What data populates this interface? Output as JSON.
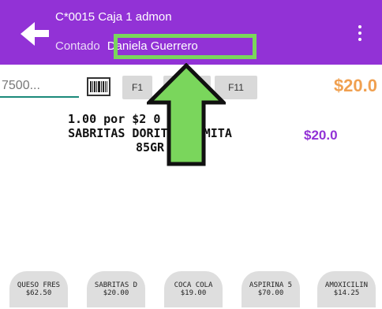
{
  "header": {
    "title": "C*0015 Caja 1 admon",
    "subtitle_prefix": "Contado",
    "cashier_name": "Daniela Guerrero",
    "background_color": "#9232d6",
    "highlight_color": "#7ad65c"
  },
  "search": {
    "value": "7500...",
    "barcode_icon": "barcode-icon"
  },
  "function_keys": [
    {
      "label": "F1"
    },
    {
      "label": "F"
    },
    {
      "label": "F11"
    }
  ],
  "total": {
    "amount": "$20.0",
    "color": "#f0a050"
  },
  "items": [
    {
      "quantity_line": "1.00 por $2  0",
      "description_line1": "SABRITAS DORITOS  NAMITA",
      "description_line2": "85GR",
      "amount": "$20.0",
      "amount_color": "#9232d6"
    }
  ],
  "quick_products": [
    {
      "name": "QUESO FRES",
      "price": "$62.50"
    },
    {
      "name": "SABRITAS D",
      "price": "$20.00"
    },
    {
      "name": "COCA COLA",
      "price": "$19.00"
    },
    {
      "name": "ASPIRINA 5",
      "price": "$70.00"
    },
    {
      "name": "AMOXICILIN",
      "price": "$14.25"
    }
  ],
  "annotation": {
    "arrow_icon": "arrow-up-icon",
    "color": "#7ad65c"
  }
}
